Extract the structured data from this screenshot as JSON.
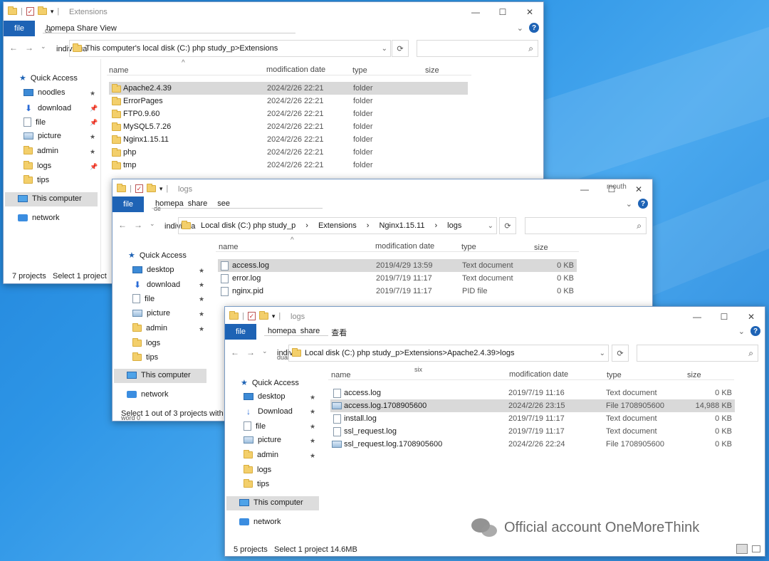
{
  "window1": {
    "title": "Extensions",
    "ribbon": {
      "file": "file",
      "tabs": "homepa Share View",
      "ghost": "ca"
    },
    "address": {
      "prefix": "individua",
      "path": "This computer's local disk (C:) php study_p>Extensions"
    },
    "sidebar": {
      "quick_access": "Quick Access",
      "items": [
        "noodles",
        "download",
        "file",
        "picture",
        "admin",
        "logs",
        "tips"
      ],
      "this_computer": "This computer",
      "network": "network"
    },
    "headers": {
      "name": "name",
      "date": "modification date",
      "type": "type",
      "size": "size"
    },
    "rows": [
      {
        "name": "Apache2.4.39",
        "date": "2024/2/26 22:21",
        "type": "folder"
      },
      {
        "name": "ErrorPages",
        "date": "2024/2/26 22:21",
        "type": "folder"
      },
      {
        "name": "FTP0.9.60",
        "date": "2024/2/26 22:21",
        "type": "folder"
      },
      {
        "name": "MySQL5.7.26",
        "date": "2024/2/26 22:21",
        "type": "folder"
      },
      {
        "name": "Nginx1.15.11",
        "date": "2024/2/26 22:21",
        "type": "folder"
      },
      {
        "name": "php",
        "date": "2024/2/26 22:21",
        "type": "folder"
      },
      {
        "name": "tmp",
        "date": "2024/2/26 22:21",
        "type": "folder"
      }
    ],
    "status": {
      "count": "7 projects",
      "selection": "Select 1 project"
    }
  },
  "window2": {
    "title": "logs",
    "tooltip": "mouth",
    "ribbon": {
      "file": "file",
      "tab1": "homepa",
      "tab2": "share",
      "tab3": "see",
      "ghost": "de"
    },
    "address": {
      "prefix": "individua",
      "seg1": "Local disk (C:) php study_p",
      "seg2": "Extensions",
      "seg3": "Nginx1.15.11",
      "seg4": "logs",
      "sep": "›"
    },
    "sidebar": {
      "quick_access": "Quick Access",
      "items": [
        "desktop",
        "download",
        "file",
        "picture",
        "admin",
        "logs",
        "tips"
      ],
      "this_computer": "This computer",
      "network": "network"
    },
    "headers": {
      "name": "name",
      "date": "modification date",
      "type": "type",
      "size": "size"
    },
    "rows": [
      {
        "name": "access.log",
        "date": "2019/4/29 13:59",
        "type": "Text document",
        "size": "0 KB"
      },
      {
        "name": "error.log",
        "date": "2019/7/19 11:17",
        "type": "Text document",
        "size": "0 KB"
      },
      {
        "name": "nginx.pid",
        "date": "2019/7/19 11:17",
        "type": "PID file",
        "size": "0 KB"
      }
    ],
    "status": {
      "text": "Select 1 out of 3 projects with the",
      "ghost": "word 0"
    }
  },
  "window3": {
    "title": "logs",
    "ribbon": {
      "file": "file",
      "tab1": "homepa",
      "tab2": "share",
      "tab3": "查看"
    },
    "address": {
      "prefix": "indivi",
      "ghost": "dual",
      "path": "Local disk (C:) php study_p>Extensions>Apache2.4.39>logs"
    },
    "sidebar": {
      "quick_access": "Quick Access",
      "items": [
        "desktop",
        "Download",
        "file",
        "picture",
        "admin",
        "logs",
        "tips"
      ],
      "this_computer": "This computer",
      "network": "network"
    },
    "headers": {
      "name": "name",
      "ghost": "six",
      "date": "modification date",
      "type": "type",
      "size": "size"
    },
    "rows": [
      {
        "name": "access.log",
        "date": "2019/7/19 11:16",
        "type": "Text document",
        "size": "0 KB"
      },
      {
        "name": "access.log.1708905600",
        "date": "2024/2/26 23:15",
        "type": "File 1708905600",
        "size": "14,988 KB"
      },
      {
        "name": "install.log",
        "date": "2019/7/19 11:17",
        "type": "Text document",
        "size": "0 KB"
      },
      {
        "name": "ssl_request.log",
        "date": "2019/7/19 11:17",
        "type": "Text document",
        "size": "0 KB"
      },
      {
        "name": "ssl_request.log.1708905600",
        "date": "2024/2/26 22:24",
        "type": "File 1708905600",
        "size": "0 KB"
      }
    ],
    "status": {
      "count": "5 projects",
      "selection": "Select 1 project 14.6MB"
    }
  },
  "watermark": "Official account OneMoreThink"
}
